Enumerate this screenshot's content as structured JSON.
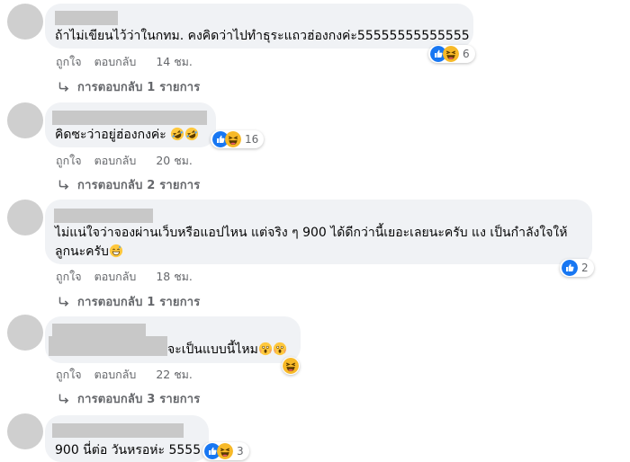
{
  "colors": {
    "like": "#1877f2",
    "haha": "#f7b928",
    "bubble": "#f0f2f5",
    "meta": "#65676b"
  },
  "actions": {
    "like": "ถูกใจ",
    "reply": "ตอบกลับ"
  },
  "comments": [
    {
      "text": "ถ้าไม่เขียนไว้ว่าในกทม. คงคิดว่าไปทำธุระแถวฮ่องกงค่ะ55555555555555",
      "time": "14 ชม.",
      "replies": "การตอบกลับ 1 รายการ",
      "reaction_count": "6",
      "reactions": [
        "like-icon",
        "haha-icon"
      ]
    },
    {
      "text": "คิดซะว่าอยู่ฮ่องกงค่ะ",
      "emojis": [
        "rolling-laughing-emoji",
        "rolling-laughing-emoji"
      ],
      "time": "20 ชม.",
      "replies": "การตอบกลับ 2 รายการ",
      "reaction_count": "16",
      "reactions": [
        "like-icon",
        "haha-icon"
      ]
    },
    {
      "text_line1": "ไม่แน่ใจว่าจองผ่านเว็บหรือแอปไหน แต่จริง ๆ 900 ได้ดีกว่านี้เยอะเลยนะครับ แง เป็นกำลังใจให้",
      "text_line2": "ลูกนะครับ",
      "emojis": [
        "grinning-sweat-emoji"
      ],
      "time": "18 ชม.",
      "replies": "การตอบกลับ 1 รายการ",
      "reaction_count": "2",
      "reactions": [
        "like-icon"
      ]
    },
    {
      "text": "จะเป็นแบบนี้ไหม",
      "emojis": [
        "screaming-emoji",
        "screaming-emoji"
      ],
      "time": "22 ชม.",
      "replies": "การตอบกลับ 3 รายการ",
      "reactions": [
        "haha-icon"
      ]
    },
    {
      "text": "900 นี่ต่อ วันหรอห่ะ 5555",
      "reaction_count": "3",
      "reactions": [
        "like-icon",
        "haha-icon"
      ]
    }
  ]
}
